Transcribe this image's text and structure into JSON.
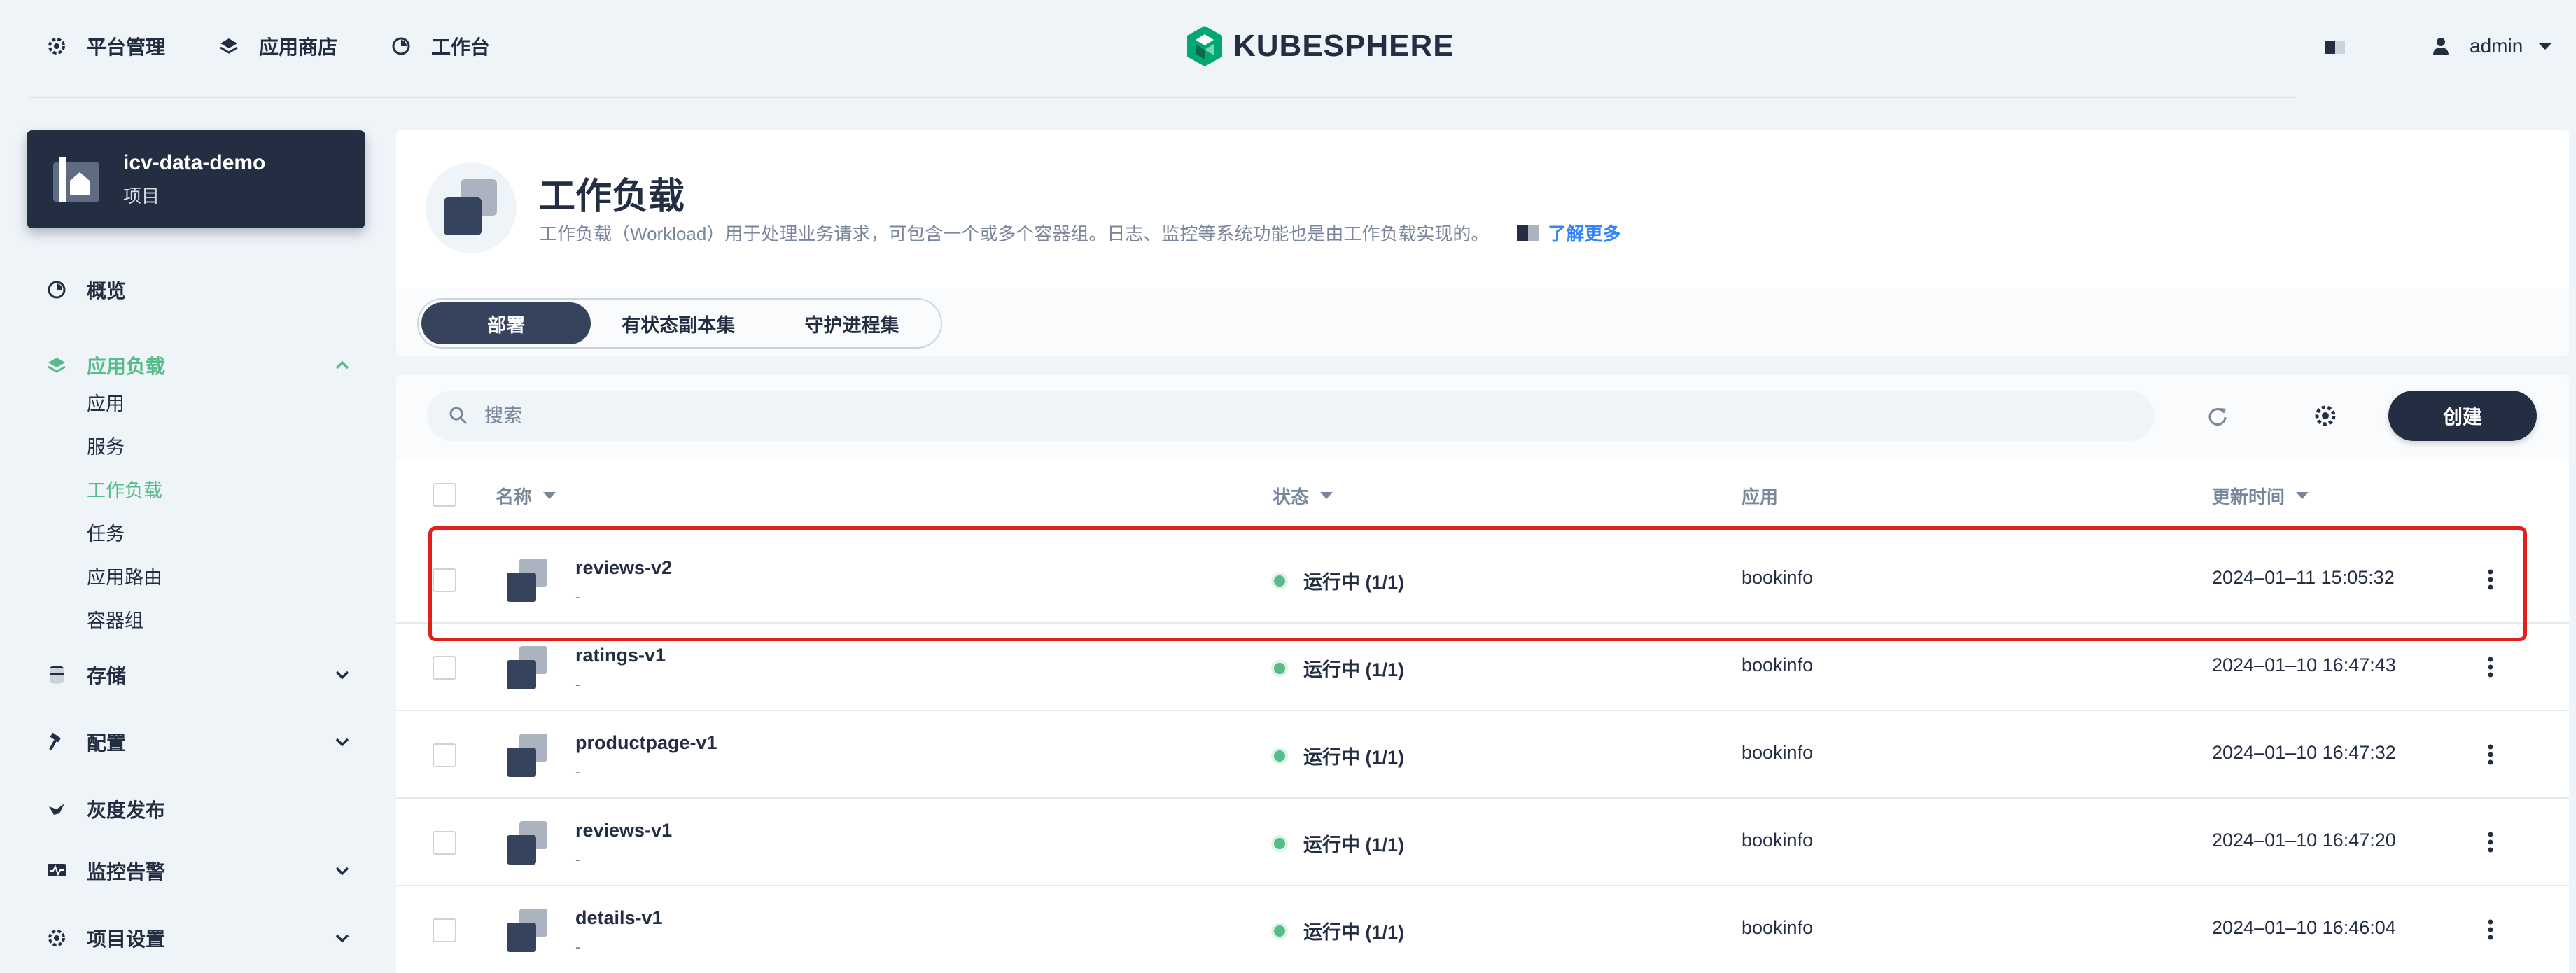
{
  "topnav": {
    "platform": "平台管理",
    "appstore": "应用商店",
    "workbench": "工作台",
    "brand": "KUBESPHERE",
    "user": "admin"
  },
  "project": {
    "name": "icv-data-demo",
    "type": "项目"
  },
  "sidebar": {
    "overview": "概览",
    "workloads_group": "应用负载",
    "sub_items": [
      "应用",
      "服务",
      "工作负载",
      "任务",
      "应用路由",
      "容器组"
    ],
    "storage": "存储",
    "config": "配置",
    "grayscale": "灰度发布",
    "monitoring": "监控告警",
    "settings": "项目设置"
  },
  "header": {
    "title": "工作负载",
    "description": "工作负载（Workload）用于处理业务请求，可包含一个或多个容器组。日志、监控等系统功能也是由工作负载实现的。",
    "learn_more": "了解更多"
  },
  "tabs": [
    "部署",
    "有状态副本集",
    "守护进程集"
  ],
  "toolbar": {
    "search_placeholder": "搜索",
    "create": "创建"
  },
  "columns": {
    "name": "名称",
    "status": "状态",
    "app": "应用",
    "updated": "更新时间"
  },
  "rows": [
    {
      "name": "reviews-v2",
      "sub": "-",
      "status": "运行中 (1/1)",
      "app": "bookinfo",
      "time": "2024–01–11 15:05:32"
    },
    {
      "name": "ratings-v1",
      "sub": "-",
      "status": "运行中 (1/1)",
      "app": "bookinfo",
      "time": "2024–01–10 16:47:43"
    },
    {
      "name": "productpage-v1",
      "sub": "-",
      "status": "运行中 (1/1)",
      "app": "bookinfo",
      "time": "2024–01–10 16:47:32"
    },
    {
      "name": "reviews-v1",
      "sub": "-",
      "status": "运行中 (1/1)",
      "app": "bookinfo",
      "time": "2024–01–10 16:47:20"
    },
    {
      "name": "details-v1",
      "sub": "-",
      "status": "运行中 (1/1)",
      "app": "bookinfo",
      "time": "2024–01–10 16:46:04"
    }
  ],
  "colors": {
    "accent": "#55bc8a",
    "dark": "#242e42",
    "highlight": "#e0201b"
  }
}
